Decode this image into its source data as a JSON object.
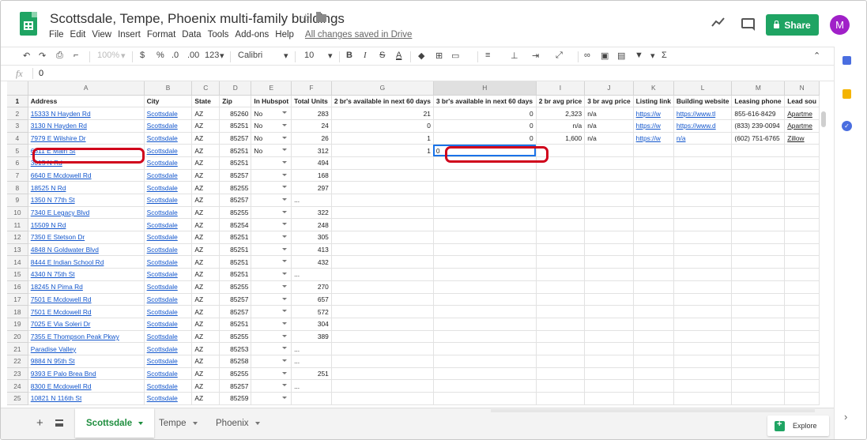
{
  "app": {
    "title": "Scottsdale, Tempe, Phoenix multi-family buildings",
    "menu": [
      "File",
      "Edit",
      "View",
      "Insert",
      "Format",
      "Data",
      "Tools",
      "Add-ons",
      "Help"
    ],
    "save_status": "All changes saved in Drive",
    "share_label": "Share",
    "avatar_initial": "M",
    "brand_color": "#1fa463",
    "avatar_color": "#a020c8"
  },
  "toolbar": {
    "zoom": "100%",
    "currency": "$",
    "percent": "%",
    "decimal_decrease": ".0",
    "decimal_increase": ".00",
    "number_format": "123",
    "font": "Calibri",
    "font_size": "10",
    "bold": "B",
    "italic": "I",
    "strike": "S",
    "text_color": "A",
    "function": "Σ"
  },
  "formula_bar": {
    "fx": "fx",
    "value": "0"
  },
  "grid": {
    "col_letters": [
      "A",
      "B",
      "C",
      "D",
      "E",
      "F",
      "G",
      "H",
      "I",
      "J",
      "K",
      "L",
      "M",
      "N"
    ],
    "headers": [
      "Address",
      "City",
      "State",
      "Zip",
      "In Hubspot",
      "Total Units",
      "2 br's available in next 60 days",
      "3 br's available in next 60 days",
      "2 br avg price",
      "3 br avg price",
      "Listing link",
      "Building website",
      "Leasing phone",
      "Lead sou"
    ],
    "rows": [
      {
        "n": "2",
        "address": "15333 N Hayden Rd",
        "city": "Scottsdale",
        "state": "AZ",
        "zip": "85260",
        "hub": "No",
        "units": "283",
        "br2": "21",
        "br3": "0",
        "p2": "2,323",
        "p3": "n/a",
        "listing": "https://w",
        "website": "https://www.tl",
        "phone": "855-616-8429",
        "lead": "Apartme"
      },
      {
        "n": "3",
        "address": "3130 N Hayden Rd",
        "city": "Scottsdale",
        "state": "AZ",
        "zip": "85251",
        "hub": "No",
        "units": "24",
        "br2": "0",
        "br3": "0",
        "p2": "n/a",
        "p3": "n/a",
        "listing": "https://w",
        "website": "https://www.d",
        "phone": "(833) 239-0094",
        "lead": "Apartme"
      },
      {
        "n": "4",
        "address": "7979 E Wilshire Dr",
        "city": "Scottsdale",
        "state": "AZ",
        "zip": "85257",
        "hub": "No",
        "units": "26",
        "br2": "1",
        "br3": "0",
        "p2": "1,600",
        "p3": "n/a",
        "listing": "https://w",
        "website": "n/a",
        "phone": "(602) 751-6765",
        "lead": "Zillow"
      },
      {
        "n": "5",
        "address": "6811 E Main St",
        "city": "Scottsdale",
        "state": "AZ",
        "zip": "85251",
        "hub": "No",
        "units": "312",
        "br2": "1",
        "br3": "0",
        "p2": "",
        "p3": "",
        "listing": "",
        "website": "",
        "phone": "",
        "lead": ""
      },
      {
        "n": "6",
        "address": "3015 N  Rd",
        "city": "Scottsdale",
        "state": "AZ",
        "zip": "85251",
        "hub": "",
        "units": "494",
        "br2": "",
        "br3": "",
        "p2": "",
        "p3": "",
        "listing": "",
        "website": "",
        "phone": "",
        "lead": ""
      },
      {
        "n": "7",
        "address": "6640 E Mcdowell Rd",
        "city": "Scottsdale",
        "state": "AZ",
        "zip": "85257",
        "hub": "",
        "units": "168",
        "br2": "",
        "br3": "",
        "p2": "",
        "p3": "",
        "listing": "",
        "website": "",
        "phone": "",
        "lead": ""
      },
      {
        "n": "8",
        "address": "18525 N  Rd",
        "city": "Scottsdale",
        "state": "AZ",
        "zip": "85255",
        "hub": "",
        "units": "297",
        "br2": "",
        "br3": "",
        "p2": "",
        "p3": "",
        "listing": "",
        "website": "",
        "phone": "",
        "lead": ""
      },
      {
        "n": "9",
        "address": "1350 N 77th St",
        "city": "Scottsdale",
        "state": "AZ",
        "zip": "85257",
        "hub": "",
        "units": "...",
        "br2": "",
        "br3": "",
        "p2": "",
        "p3": "",
        "listing": "",
        "website": "",
        "phone": "",
        "lead": ""
      },
      {
        "n": "10",
        "address": "7340 E Legacy Blvd",
        "city": "Scottsdale",
        "state": "AZ",
        "zip": "85255",
        "hub": "",
        "units": "322",
        "br2": "",
        "br3": "",
        "p2": "",
        "p3": "",
        "listing": "",
        "website": "",
        "phone": "",
        "lead": ""
      },
      {
        "n": "11",
        "address": "15509 N  Rd",
        "city": "Scottsdale",
        "state": "AZ",
        "zip": "85254",
        "hub": "",
        "units": "248",
        "br2": "",
        "br3": "",
        "p2": "",
        "p3": "",
        "listing": "",
        "website": "",
        "phone": "",
        "lead": ""
      },
      {
        "n": "12",
        "address": "7350 E Stetson Dr",
        "city": "Scottsdale",
        "state": "AZ",
        "zip": "85251",
        "hub": "",
        "units": "305",
        "br2": "",
        "br3": "",
        "p2": "",
        "p3": "",
        "listing": "",
        "website": "",
        "phone": "",
        "lead": ""
      },
      {
        "n": "13",
        "address": "4848 N Goldwater Blvd",
        "city": "Scottsdale",
        "state": "AZ",
        "zip": "85251",
        "hub": "",
        "units": "413",
        "br2": "",
        "br3": "",
        "p2": "",
        "p3": "",
        "listing": "",
        "website": "",
        "phone": "",
        "lead": ""
      },
      {
        "n": "14",
        "address": "8444 E Indian School Rd",
        "city": "Scottsdale",
        "state": "AZ",
        "zip": "85251",
        "hub": "",
        "units": "432",
        "br2": "",
        "br3": "",
        "p2": "",
        "p3": "",
        "listing": "",
        "website": "",
        "phone": "",
        "lead": ""
      },
      {
        "n": "15",
        "address": "4340 N 75th St",
        "city": "Scottsdale",
        "state": "AZ",
        "zip": "85251",
        "hub": "",
        "units": "...",
        "br2": "",
        "br3": "",
        "p2": "",
        "p3": "",
        "listing": "",
        "website": "",
        "phone": "",
        "lead": ""
      },
      {
        "n": "16",
        "address": "18245 N Pima Rd",
        "city": "Scottsdale",
        "state": "AZ",
        "zip": "85255",
        "hub": "",
        "units": "270",
        "br2": "",
        "br3": "",
        "p2": "",
        "p3": "",
        "listing": "",
        "website": "",
        "phone": "",
        "lead": ""
      },
      {
        "n": "17",
        "address": "7501 E Mcdowell Rd",
        "city": "Scottsdale",
        "state": "AZ",
        "zip": "85257",
        "hub": "",
        "units": "657",
        "br2": "",
        "br3": "",
        "p2": "",
        "p3": "",
        "listing": "",
        "website": "",
        "phone": "",
        "lead": ""
      },
      {
        "n": "18",
        "address": "7501 E Mcdowell Rd",
        "city": "Scottsdale",
        "state": "AZ",
        "zip": "85257",
        "hub": "",
        "units": "572",
        "br2": "",
        "br3": "",
        "p2": "",
        "p3": "",
        "listing": "",
        "website": "",
        "phone": "",
        "lead": ""
      },
      {
        "n": "19",
        "address": "7025 E Via Soleri Dr",
        "city": "Scottsdale",
        "state": "AZ",
        "zip": "85251",
        "hub": "",
        "units": "304",
        "br2": "",
        "br3": "",
        "p2": "",
        "p3": "",
        "listing": "",
        "website": "",
        "phone": "",
        "lead": ""
      },
      {
        "n": "20",
        "address": "7355 E Thompson Peak Pkwy",
        "city": "Scottsdale",
        "state": "AZ",
        "zip": "85255",
        "hub": "",
        "units": "389",
        "br2": "",
        "br3": "",
        "p2": "",
        "p3": "",
        "listing": "",
        "website": "",
        "phone": "",
        "lead": ""
      },
      {
        "n": "21",
        "address": "Paradise Valley",
        "city": "Scottsdale",
        "state": "AZ",
        "zip": "85253",
        "hub": "",
        "units": "...",
        "br2": "",
        "br3": "",
        "p2": "",
        "p3": "",
        "listing": "",
        "website": "",
        "phone": "",
        "lead": ""
      },
      {
        "n": "22",
        "address": "9884 N 95th St",
        "city": "Scottsdale",
        "state": "AZ",
        "zip": "85258",
        "hub": "",
        "units": "...",
        "br2": "",
        "br3": "",
        "p2": "",
        "p3": "",
        "listing": "",
        "website": "",
        "phone": "",
        "lead": ""
      },
      {
        "n": "23",
        "address": "9393 E Palo Brea Bnd",
        "city": "Scottsdale",
        "state": "AZ",
        "zip": "85255",
        "hub": "",
        "units": "251",
        "br2": "",
        "br3": "",
        "p2": "",
        "p3": "",
        "listing": "",
        "website": "",
        "phone": "",
        "lead": ""
      },
      {
        "n": "24",
        "address": "8300 E Mcdowell Rd",
        "city": "Scottsdale",
        "state": "AZ",
        "zip": "85257",
        "hub": "",
        "units": "...",
        "br2": "",
        "br3": "",
        "p2": "",
        "p3": "",
        "listing": "",
        "website": "",
        "phone": "",
        "lead": ""
      },
      {
        "n": "25",
        "address": "10821 N 116th St",
        "city": "Scottsdale",
        "state": "AZ",
        "zip": "85259",
        "hub": "",
        "units": "",
        "br2": "",
        "br3": "",
        "p2": "",
        "p3": "",
        "listing": "",
        "website": "",
        "phone": "",
        "lead": ""
      }
    ],
    "active_cell_value": "0"
  },
  "sheets": {
    "tabs": [
      "Scottsdale",
      "Tempe",
      "Phoenix"
    ],
    "active": "Scottsdale",
    "explore_label": "Explore"
  },
  "annotation_color": "#d0021b"
}
